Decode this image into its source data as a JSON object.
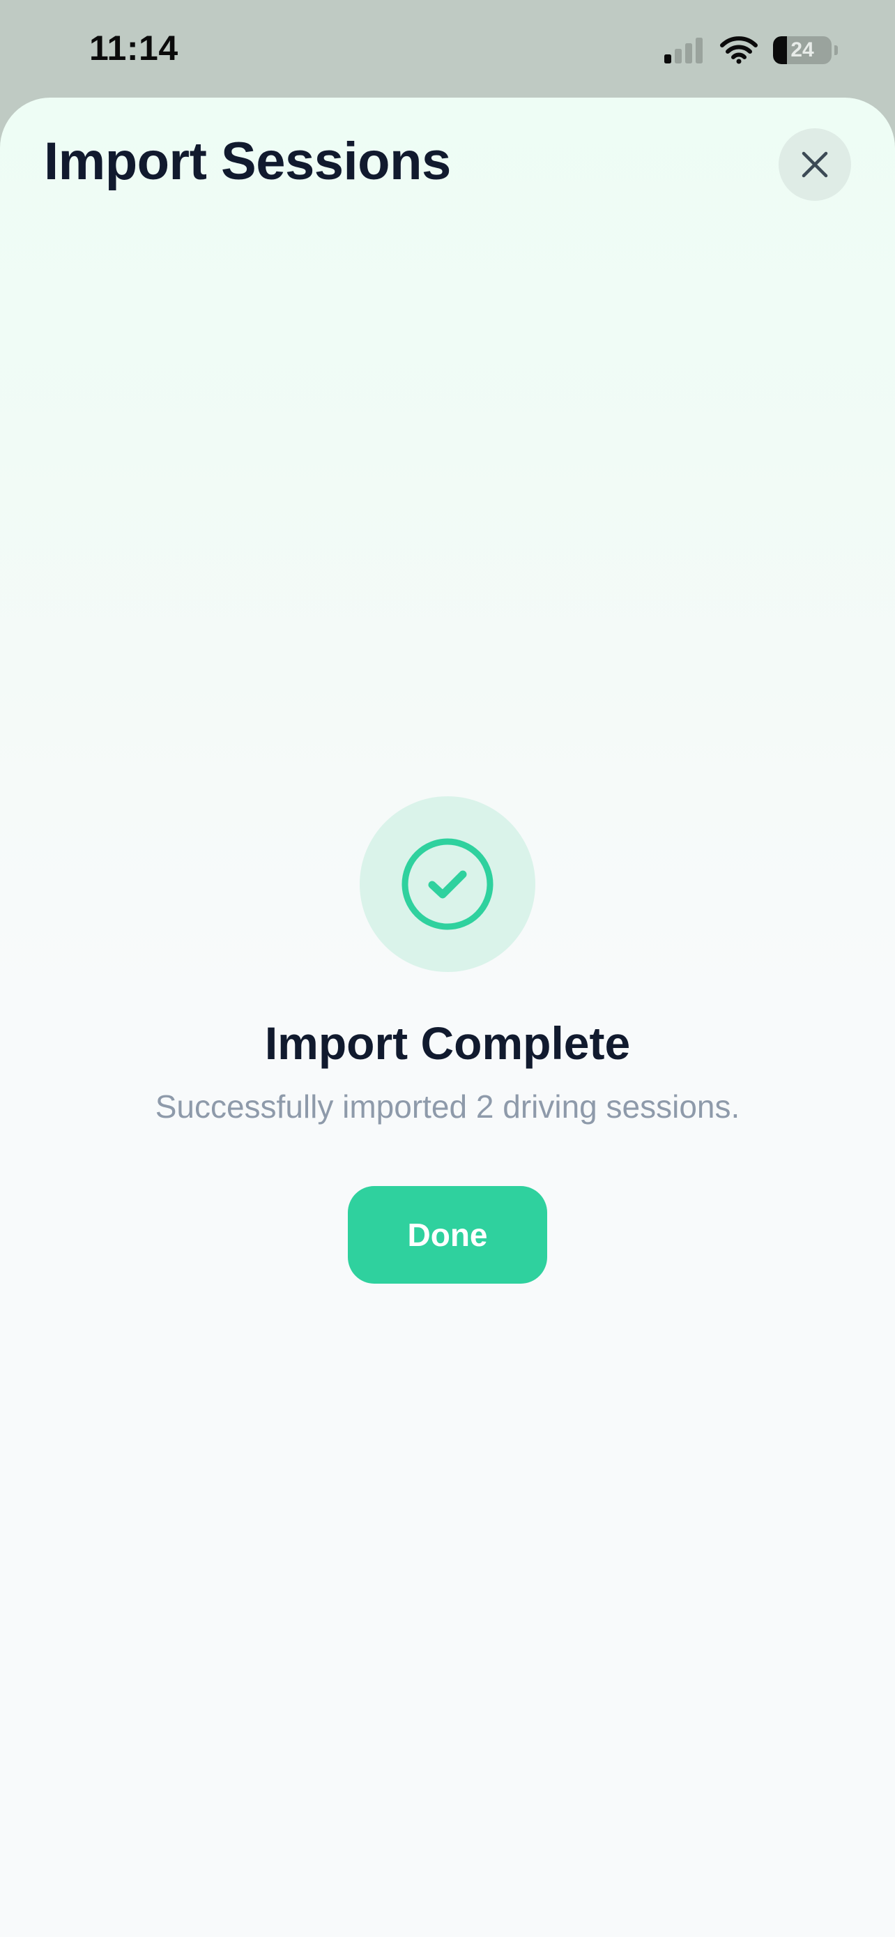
{
  "status_bar": {
    "time": "11:14",
    "battery_level": "24",
    "battery_fraction": 0.24,
    "icons": [
      "cellular-signal-icon",
      "wifi-icon",
      "battery-icon"
    ]
  },
  "sheet": {
    "title": "Import Sessions",
    "close_icon": "close-icon"
  },
  "result": {
    "icon": "check-circle-icon",
    "title": "Import Complete",
    "message": "Successfully imported 2 driving sessions.",
    "done_label": "Done"
  },
  "colors": {
    "accent": "#2fd19e",
    "accent_light": "#daf3ea",
    "title_text": "#111a2e",
    "muted_text": "#8e9aaa"
  }
}
